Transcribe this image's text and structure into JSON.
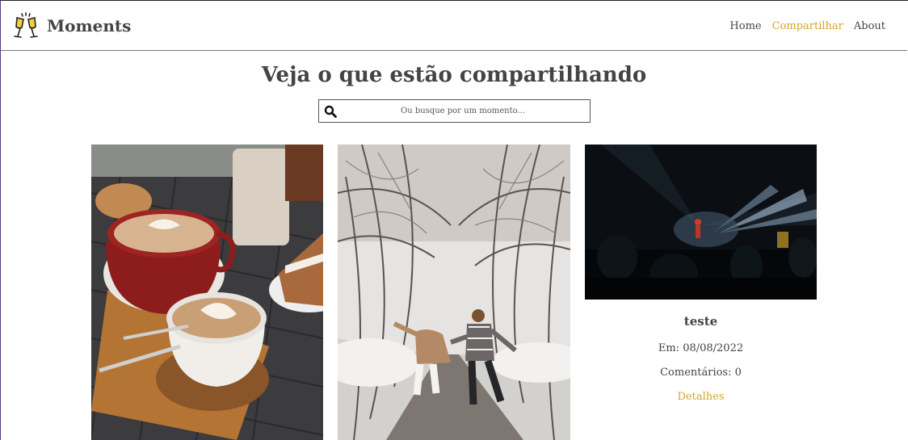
{
  "brand": {
    "name": "Moments",
    "logo_icon": "champagne-toast-icon"
  },
  "nav": {
    "home": "Home",
    "share": "Compartilhar",
    "about": "About",
    "active_color": "#d4a52a"
  },
  "page": {
    "title": "Veja o que estão compartilhando"
  },
  "search": {
    "placeholder": "Ou busque por um momento...",
    "icon": "search-icon"
  },
  "moments": [
    {
      "image": "coffee-cups-photo"
    },
    {
      "image": "snowy-road-couple-photo"
    },
    {
      "image": "concert-stage-photo",
      "title": "teste",
      "date": "Em: 08/08/2022",
      "comments": "Comentários: 0",
      "details": "Detalhes"
    }
  ]
}
